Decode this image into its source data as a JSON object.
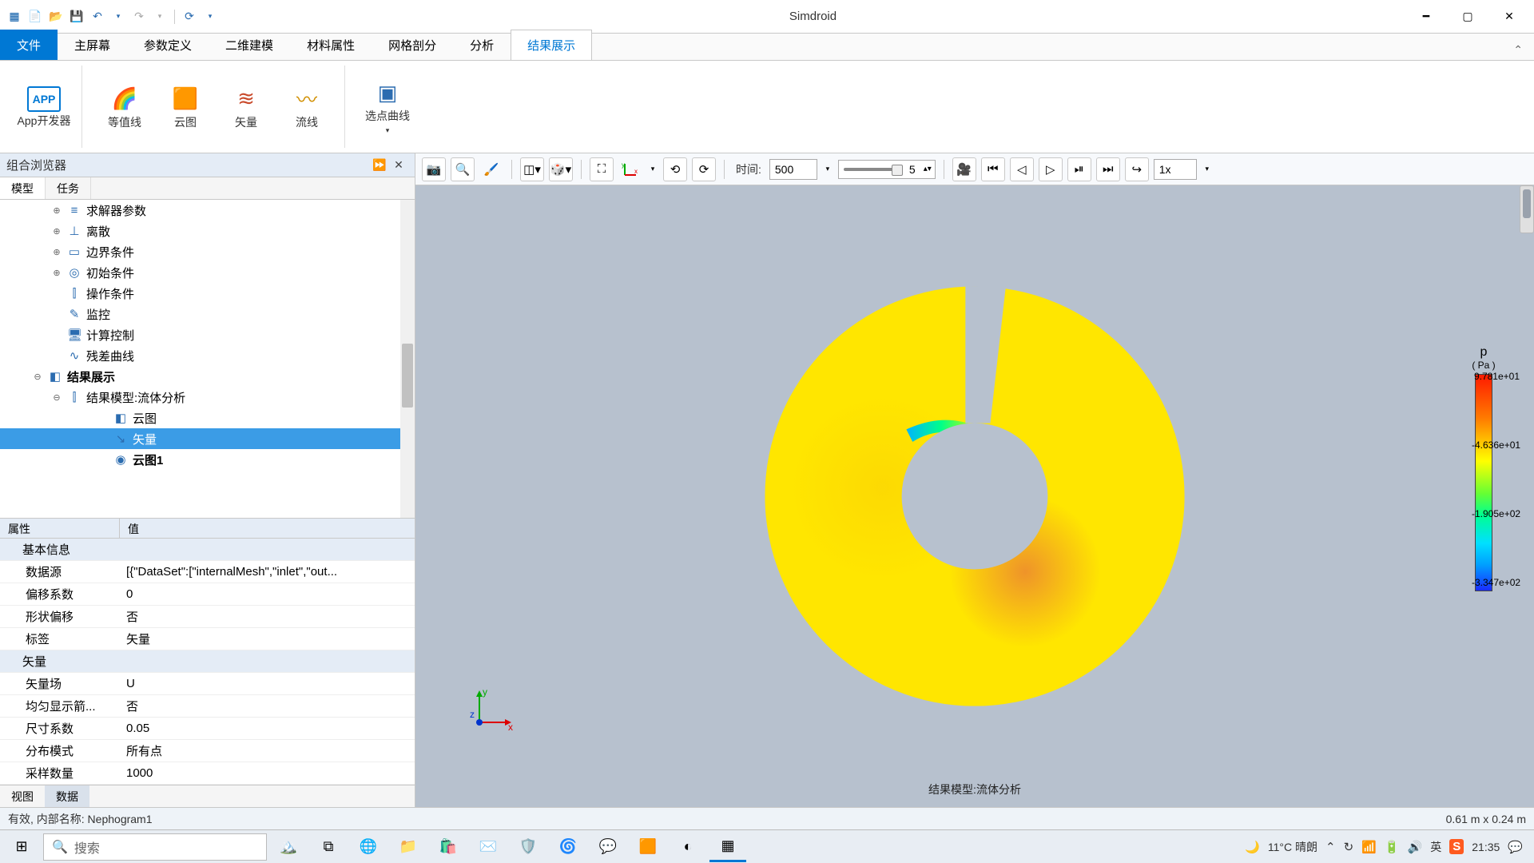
{
  "title": "Simdroid",
  "qat": [
    "logo",
    "new",
    "open",
    "save",
    "undo",
    "undo-dd",
    "redo",
    "redo-dd",
    "sep",
    "refresh",
    "refresh-dd"
  ],
  "ribbonTabs": {
    "file": "文件",
    "items": [
      "主屏幕",
      "参数定义",
      "二维建模",
      "材料属性",
      "网格剖分",
      "分析",
      "结果展示"
    ],
    "activeIndex": 6
  },
  "ribbonButtons": [
    {
      "label": "App开发器",
      "icon": "APP",
      "color": "#0078d4"
    },
    {
      "label": "等值线",
      "icon": "◉",
      "color": "#d18f00"
    },
    {
      "label": "云图",
      "icon": "◉",
      "color": "#0aa86b"
    },
    {
      "label": "矢量",
      "icon": "≋",
      "color": "#c94a2b"
    },
    {
      "label": "流线",
      "icon": "〰",
      "color": "#d18f00"
    },
    {
      "label": "选点曲线",
      "icon": "▣",
      "color": "#2b6cb0",
      "caret": true
    }
  ],
  "browser": {
    "title": "组合浏览器",
    "subtabs": [
      "模型",
      "任务"
    ],
    "subtabActive": 0,
    "tree": [
      {
        "label": "求解器参数",
        "icon": "≡",
        "exp": "⊕",
        "indent": 0
      },
      {
        "label": "离散",
        "icon": "⊥",
        "exp": "⊕",
        "indent": 0
      },
      {
        "label": "边界条件",
        "icon": "▭",
        "exp": "⊕",
        "indent": 0
      },
      {
        "label": "初始条件",
        "icon": "◎",
        "exp": "⊕",
        "indent": 0
      },
      {
        "label": "操作条件",
        "icon": "⫿",
        "exp": "",
        "indent": 0
      },
      {
        "label": "监控",
        "icon": "✎",
        "exp": "",
        "indent": 0
      },
      {
        "label": "计算控制",
        "icon": "🖥",
        "exp": "",
        "indent": 0
      },
      {
        "label": "残差曲线",
        "icon": "∿",
        "exp": "",
        "indent": 0
      },
      {
        "label": "结果展示",
        "icon": "◧",
        "exp": "⊖",
        "indent": -1,
        "bold": true
      },
      {
        "label": "结果模型:流体分析",
        "icon": "⫿",
        "exp": "⊖",
        "indent": 0
      },
      {
        "label": "云图",
        "icon": "◧",
        "exp": "",
        "indent": 2
      },
      {
        "label": "矢量",
        "icon": "↘",
        "exp": "",
        "indent": 2,
        "sel": true
      },
      {
        "label": "云图1",
        "icon": "◉",
        "exp": "",
        "indent": 2,
        "bold": true
      }
    ]
  },
  "props": {
    "headers": [
      "属性",
      "值"
    ],
    "sections": [
      {
        "title": "基本信息",
        "rows": [
          {
            "k": "数据源",
            "v": "[{\"DataSet\":[\"internalMesh\",\"inlet\",\"out..."
          },
          {
            "k": "偏移系数",
            "v": "0"
          },
          {
            "k": "形状偏移",
            "v": "否"
          },
          {
            "k": "标签",
            "v": "矢量"
          }
        ]
      },
      {
        "title": "矢量",
        "rows": [
          {
            "k": "矢量场",
            "v": "U"
          },
          {
            "k": "均匀显示箭...",
            "v": "否"
          },
          {
            "k": "尺寸系数",
            "v": "0.05"
          },
          {
            "k": "分布模式",
            "v": "所有点"
          },
          {
            "k": "采样数量",
            "v": "1000"
          }
        ]
      }
    ]
  },
  "bottomTabs": {
    "items": [
      "视图",
      "数据"
    ],
    "active": 1
  },
  "viewportToolbar": {
    "timeLabel": "时间:",
    "timeValue": "500",
    "sliderValue": "5",
    "speed": "1x"
  },
  "viewportCaption": "结果模型:流体分析",
  "legend": {
    "symbol": "p",
    "unit": "( Pa )",
    "ticks": [
      "9.781e+01",
      "-4.636e+01",
      "-1.905e+02",
      "-3.347e+02"
    ]
  },
  "statusbar": {
    "left": "有效, 内部名称: Nephogram1",
    "right": "0.61 m x 0.24 m"
  },
  "taskbar": {
    "searchPlaceholder": "搜索",
    "weather": "11°C 晴朗",
    "ime": "英",
    "clock": "21:35"
  }
}
